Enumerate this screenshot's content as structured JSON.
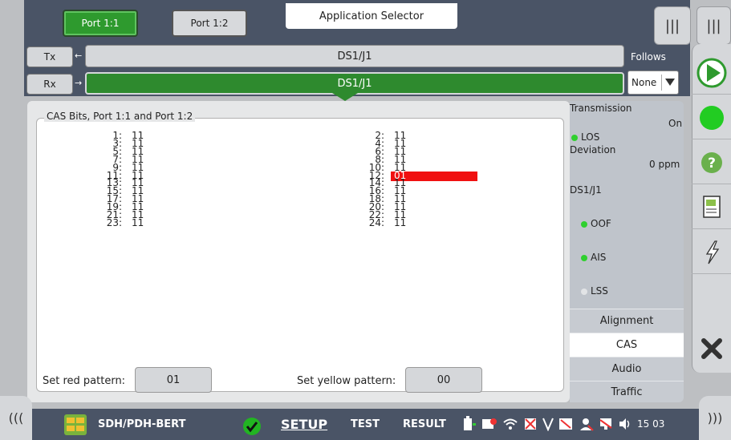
{
  "ports": {
    "port1": "Port 1:1",
    "port2": "Port 1:2"
  },
  "app_selector": "Application Selector",
  "signal": {
    "tx_label": "Tx",
    "rx_label": "Rx",
    "tx_signal": "DS1/J1",
    "rx_signal": "DS1/J1",
    "follows_label": "Follows",
    "follows_value": "None"
  },
  "cas": {
    "title": "CAS Bits, Port 1:1 and Port 1:2",
    "rows_left": [
      {
        "num": "1:",
        "val": "11"
      },
      {
        "num": "3:",
        "val": "11"
      },
      {
        "num": "5:",
        "val": "11"
      },
      {
        "num": "7:",
        "val": "11"
      },
      {
        "num": "9:",
        "val": "11"
      },
      {
        "num": "11:",
        "val": "11"
      },
      {
        "num": "13:",
        "val": "11"
      },
      {
        "num": "15:",
        "val": "11"
      },
      {
        "num": "17:",
        "val": "11"
      },
      {
        "num": "19:",
        "val": "11"
      },
      {
        "num": "21:",
        "val": "11"
      },
      {
        "num": "23:",
        "val": "11"
      }
    ],
    "rows_right": [
      {
        "num": "2:",
        "val": "11"
      },
      {
        "num": "4:",
        "val": "11"
      },
      {
        "num": "6:",
        "val": "11"
      },
      {
        "num": "8:",
        "val": "11"
      },
      {
        "num": "10:",
        "val": "11"
      },
      {
        "num": "12:",
        "val": "01",
        "highlight": "red"
      },
      {
        "num": "14:",
        "val": "11"
      },
      {
        "num": "16:",
        "val": "11"
      },
      {
        "num": "18:",
        "val": "11"
      },
      {
        "num": "20:",
        "val": "11"
      },
      {
        "num": "22:",
        "val": "11"
      },
      {
        "num": "24:",
        "val": "11"
      }
    ],
    "set_red_label": "Set red pattern:",
    "set_red_value": "01",
    "set_yellow_label": "Set yellow pattern:",
    "set_yellow_value": "00"
  },
  "status": {
    "transmission_label": "Transmission",
    "transmission_value": "On",
    "los_label": "LOS",
    "deviation_label": "Deviation",
    "deviation_value": "0 ppm",
    "section_label": "DS1/J1",
    "oof_label": "OOF",
    "ais_label": "AIS",
    "lss_label": "LSS"
  },
  "nav_tabs": [
    "Alignment",
    "CAS",
    "Audio",
    "Traffic"
  ],
  "nav_active": "CAS",
  "bottom": {
    "app_name": "SDH/PDH-BERT",
    "setup": "SETUP",
    "test": "TEST",
    "result": "RESULT",
    "clock": "15 03"
  },
  "colors": {
    "green": "#2e9a2e",
    "red": "#f01010",
    "led_green": "#2fd02f"
  }
}
